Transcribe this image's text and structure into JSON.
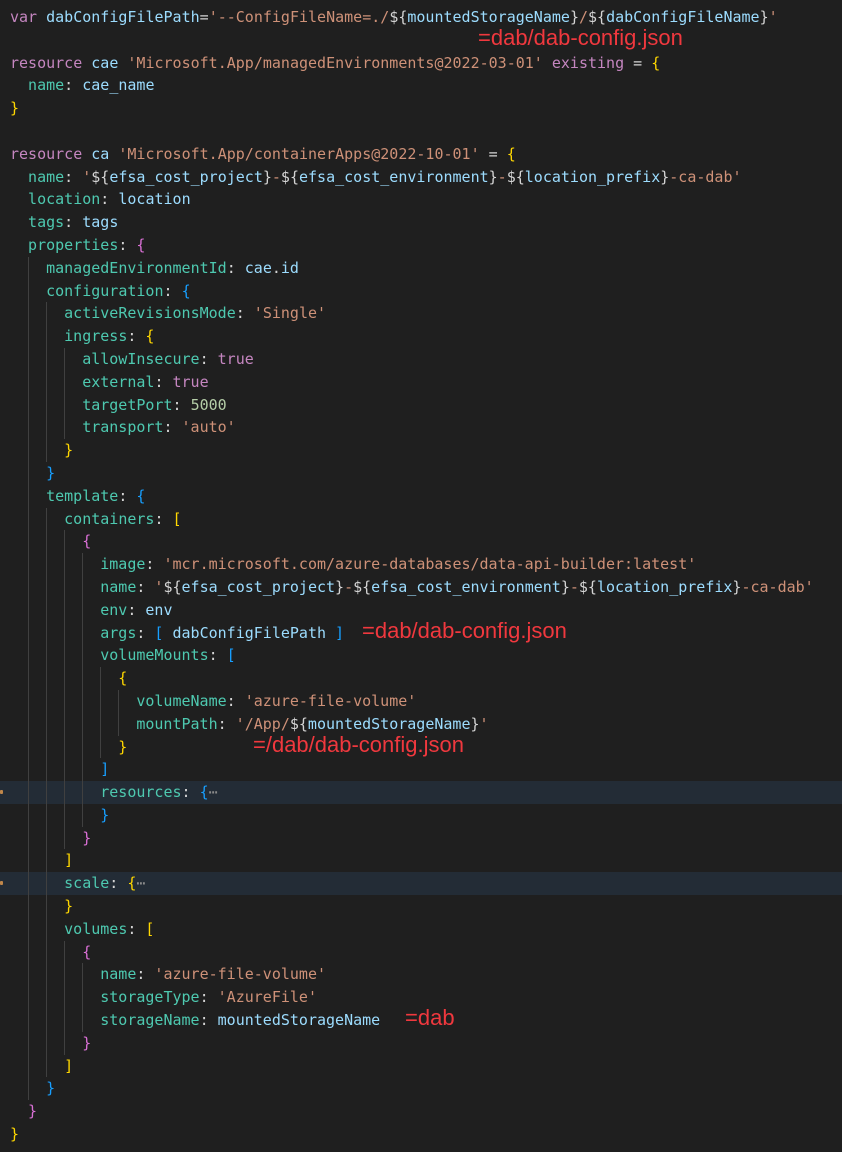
{
  "editor": {
    "language": "bicep",
    "lines": [
      {
        "indent": 0,
        "tokens": [
          [
            "kw",
            "var"
          ],
          [
            "p",
            " "
          ],
          [
            "id",
            "dabConfigFilePath"
          ],
          [
            "p",
            "="
          ],
          [
            "str",
            "'--ConfigFileName=./"
          ],
          [
            "p",
            "${"
          ],
          [
            "id",
            "mountedStorageName"
          ],
          [
            "p",
            "}"
          ],
          [
            "str",
            "/"
          ],
          [
            "p",
            "${"
          ],
          [
            "id",
            "dabConfigFileName"
          ],
          [
            "p",
            "}"
          ],
          [
            "str",
            "'"
          ]
        ]
      },
      {
        "indent": 0,
        "tokens": [],
        "note": "=dab/dab-config.json"
      },
      {
        "indent": 0,
        "tokens": [
          [
            "kw",
            "resource"
          ],
          [
            "p",
            " "
          ],
          [
            "id",
            "cae"
          ],
          [
            "p",
            " "
          ],
          [
            "str",
            "'Microsoft.App/managedEnvironments@2022-03-01'"
          ],
          [
            "p",
            " "
          ],
          [
            "kw",
            "existing"
          ],
          [
            "p",
            " = "
          ],
          [
            "b1",
            "{"
          ]
        ]
      },
      {
        "indent": 1,
        "tokens": [
          [
            "prop",
            "name"
          ],
          [
            "p",
            ": "
          ],
          [
            "id",
            "cae_name"
          ]
        ]
      },
      {
        "indent": 0,
        "tokens": [
          [
            "b1",
            "}"
          ]
        ]
      },
      {
        "indent": 0,
        "tokens": []
      },
      {
        "indent": 0,
        "tokens": [
          [
            "kw",
            "resource"
          ],
          [
            "p",
            " "
          ],
          [
            "id",
            "ca"
          ],
          [
            "p",
            " "
          ],
          [
            "str",
            "'Microsoft.App/containerApps@2022-10-01'"
          ],
          [
            "p",
            " = "
          ],
          [
            "b1",
            "{"
          ]
        ]
      },
      {
        "indent": 1,
        "tokens": [
          [
            "prop",
            "name"
          ],
          [
            "p",
            ": "
          ],
          [
            "str",
            "'"
          ],
          [
            "p",
            "${"
          ],
          [
            "id",
            "efsa_cost_project"
          ],
          [
            "p",
            "}"
          ],
          [
            "str",
            "-"
          ],
          [
            "p",
            "${"
          ],
          [
            "id",
            "efsa_cost_environment"
          ],
          [
            "p",
            "}"
          ],
          [
            "str",
            "-"
          ],
          [
            "p",
            "${"
          ],
          [
            "id",
            "location_prefix"
          ],
          [
            "p",
            "}"
          ],
          [
            "str",
            "-ca-dab'"
          ]
        ]
      },
      {
        "indent": 1,
        "tokens": [
          [
            "prop",
            "location"
          ],
          [
            "p",
            ": "
          ],
          [
            "id",
            "location"
          ]
        ]
      },
      {
        "indent": 1,
        "tokens": [
          [
            "prop",
            "tags"
          ],
          [
            "p",
            ": "
          ],
          [
            "id",
            "tags"
          ]
        ]
      },
      {
        "indent": 1,
        "tokens": [
          [
            "prop",
            "properties"
          ],
          [
            "p",
            ": "
          ],
          [
            "b2",
            "{"
          ]
        ]
      },
      {
        "indent": 2,
        "tokens": [
          [
            "prop",
            "managedEnvironmentId"
          ],
          [
            "p",
            ": "
          ],
          [
            "id",
            "cae"
          ],
          [
            "p",
            "."
          ],
          [
            "id",
            "id"
          ]
        ]
      },
      {
        "indent": 2,
        "tokens": [
          [
            "prop",
            "configuration"
          ],
          [
            "p",
            ": "
          ],
          [
            "b3",
            "{"
          ]
        ]
      },
      {
        "indent": 3,
        "tokens": [
          [
            "prop",
            "activeRevisionsMode"
          ],
          [
            "p",
            ": "
          ],
          [
            "str",
            "'Single'"
          ]
        ]
      },
      {
        "indent": 3,
        "tokens": [
          [
            "prop",
            "ingress"
          ],
          [
            "p",
            ": "
          ],
          [
            "b1",
            "{"
          ]
        ]
      },
      {
        "indent": 4,
        "tokens": [
          [
            "prop",
            "allowInsecure"
          ],
          [
            "p",
            ": "
          ],
          [
            "kw",
            "true"
          ]
        ]
      },
      {
        "indent": 4,
        "tokens": [
          [
            "prop",
            "external"
          ],
          [
            "p",
            ": "
          ],
          [
            "kw",
            "true"
          ]
        ]
      },
      {
        "indent": 4,
        "tokens": [
          [
            "prop",
            "targetPort"
          ],
          [
            "p",
            ": "
          ],
          [
            "num",
            "5000"
          ]
        ]
      },
      {
        "indent": 4,
        "tokens": [
          [
            "prop",
            "transport"
          ],
          [
            "p",
            ": "
          ],
          [
            "str",
            "'auto'"
          ]
        ]
      },
      {
        "indent": 3,
        "tokens": [
          [
            "b1",
            "}"
          ]
        ]
      },
      {
        "indent": 2,
        "tokens": [
          [
            "b3",
            "}"
          ]
        ]
      },
      {
        "indent": 2,
        "tokens": [
          [
            "prop",
            "template"
          ],
          [
            "p",
            ": "
          ],
          [
            "b3",
            "{"
          ]
        ]
      },
      {
        "indent": 3,
        "tokens": [
          [
            "prop",
            "containers"
          ],
          [
            "p",
            ": "
          ],
          [
            "b1",
            "["
          ]
        ]
      },
      {
        "indent": 4,
        "tokens": [
          [
            "b2",
            "{"
          ]
        ]
      },
      {
        "indent": 5,
        "tokens": [
          [
            "prop",
            "image"
          ],
          [
            "p",
            ": "
          ],
          [
            "str",
            "'mcr.microsoft.com/azure-databases/data-api-builder:latest'"
          ]
        ]
      },
      {
        "indent": 5,
        "tokens": [
          [
            "prop",
            "name"
          ],
          [
            "p",
            ": "
          ],
          [
            "str",
            "'"
          ],
          [
            "p",
            "${"
          ],
          [
            "id",
            "efsa_cost_project"
          ],
          [
            "p",
            "}"
          ],
          [
            "str",
            "-"
          ],
          [
            "p",
            "${"
          ],
          [
            "id",
            "efsa_cost_environment"
          ],
          [
            "p",
            "}"
          ],
          [
            "str",
            "-"
          ],
          [
            "p",
            "${"
          ],
          [
            "id",
            "location_prefix"
          ],
          [
            "p",
            "}"
          ],
          [
            "str",
            "-ca-dab'"
          ]
        ]
      },
      {
        "indent": 5,
        "tokens": [
          [
            "prop",
            "env"
          ],
          [
            "p",
            ": "
          ],
          [
            "id",
            "env"
          ]
        ]
      },
      {
        "indent": 5,
        "tokens": [
          [
            "prop",
            "args"
          ],
          [
            "p",
            ": "
          ],
          [
            "b3",
            "["
          ],
          [
            "p",
            " "
          ],
          [
            "id",
            "dabConfigFilePath"
          ],
          [
            "p",
            " "
          ],
          [
            "b3",
            "]"
          ]
        ],
        "note": "=dab/dab-config.json"
      },
      {
        "indent": 5,
        "tokens": [
          [
            "prop",
            "volumeMounts"
          ],
          [
            "p",
            ": "
          ],
          [
            "b3",
            "["
          ]
        ]
      },
      {
        "indent": 6,
        "tokens": [
          [
            "b1",
            "{"
          ]
        ]
      },
      {
        "indent": 7,
        "tokens": [
          [
            "prop",
            "volumeName"
          ],
          [
            "p",
            ": "
          ],
          [
            "str",
            "'azure-file-volume'"
          ]
        ]
      },
      {
        "indent": 7,
        "tokens": [
          [
            "prop",
            "mountPath"
          ],
          [
            "p",
            ": "
          ],
          [
            "str",
            "'/App/"
          ],
          [
            "p",
            "${"
          ],
          [
            "id",
            "mountedStorageName"
          ],
          [
            "p",
            "}"
          ],
          [
            "str",
            "'"
          ]
        ]
      },
      {
        "indent": 6,
        "tokens": [
          [
            "b1",
            "}"
          ]
        ],
        "note": "=/dab/dab-config.json"
      },
      {
        "indent": 5,
        "tokens": [
          [
            "b3",
            "]"
          ]
        ]
      },
      {
        "indent": 5,
        "tokens": [
          [
            "prop",
            "resources"
          ],
          [
            "p",
            ": "
          ],
          [
            "b3",
            "{"
          ],
          [
            "ell",
            "⋯"
          ]
        ],
        "highlight": true,
        "folded": true
      },
      {
        "indent": 5,
        "tokens": [
          [
            "b3",
            "}"
          ]
        ]
      },
      {
        "indent": 4,
        "tokens": [
          [
            "b2",
            "}"
          ]
        ]
      },
      {
        "indent": 3,
        "tokens": [
          [
            "b1",
            "]"
          ]
        ]
      },
      {
        "indent": 3,
        "tokens": [
          [
            "prop",
            "scale"
          ],
          [
            "p",
            ": "
          ],
          [
            "b1",
            "{"
          ],
          [
            "ell",
            "⋯"
          ]
        ],
        "highlight": true,
        "folded": true
      },
      {
        "indent": 3,
        "tokens": [
          [
            "b1",
            "}"
          ]
        ]
      },
      {
        "indent": 3,
        "tokens": [
          [
            "prop",
            "volumes"
          ],
          [
            "p",
            ": "
          ],
          [
            "b1",
            "["
          ]
        ]
      },
      {
        "indent": 4,
        "tokens": [
          [
            "b2",
            "{"
          ]
        ]
      },
      {
        "indent": 5,
        "tokens": [
          [
            "prop",
            "name"
          ],
          [
            "p",
            ": "
          ],
          [
            "str",
            "'azure-file-volume'"
          ]
        ]
      },
      {
        "indent": 5,
        "tokens": [
          [
            "prop",
            "storageType"
          ],
          [
            "p",
            ": "
          ],
          [
            "str",
            "'AzureFile'"
          ]
        ]
      },
      {
        "indent": 5,
        "tokens": [
          [
            "prop",
            "storageName"
          ],
          [
            "p",
            ": "
          ],
          [
            "id",
            "mountedStorageName"
          ]
        ],
        "note": "=dab"
      },
      {
        "indent": 4,
        "tokens": [
          [
            "b2",
            "}"
          ]
        ]
      },
      {
        "indent": 3,
        "tokens": [
          [
            "b1",
            "]"
          ]
        ]
      },
      {
        "indent": 2,
        "tokens": [
          [
            "b3",
            "}"
          ]
        ]
      },
      {
        "indent": 1,
        "tokens": [
          [
            "b2",
            "}"
          ]
        ]
      },
      {
        "indent": 0,
        "tokens": [
          [
            "b1",
            "}"
          ]
        ]
      }
    ]
  }
}
